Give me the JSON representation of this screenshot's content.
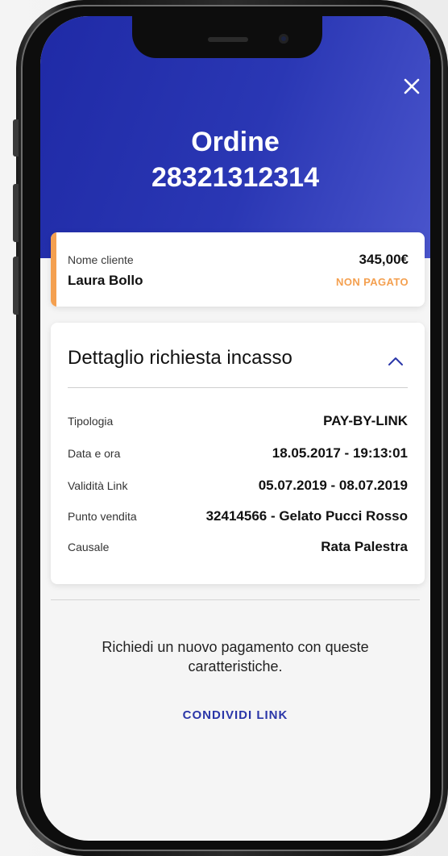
{
  "header": {
    "title_line1": "Ordine",
    "title_line2": "28321312314",
    "close_icon": "close-icon"
  },
  "customer": {
    "label": "Nome cliente",
    "name": "Laura Bollo",
    "amount": "345,00€",
    "status": "NON PAGATO"
  },
  "detail": {
    "title": "Dettaglio richiesta incasso",
    "rows": [
      {
        "label": "Tipologia",
        "value": "PAY-BY-LINK"
      },
      {
        "label": "Data e ora",
        "value": "18.05.2017 - 19:13:01"
      },
      {
        "label": "Validità Link",
        "value": "05.07.2019 - 08.07.2019"
      },
      {
        "label": "Punto vendita",
        "value": "32414566 - Gelato Pucci Rosso"
      },
      {
        "label": "Causale",
        "value": "Rata Palestra"
      }
    ]
  },
  "footer": {
    "message": "Richiedi un nuovo pagamento con queste caratteristiche.",
    "share_label": "CONDIVIDI LINK"
  },
  "colors": {
    "header": "#2a37b4",
    "accent": "#f4a050",
    "link": "#2a36a8"
  }
}
